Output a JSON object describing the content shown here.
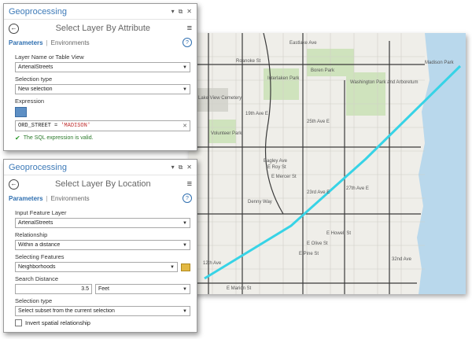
{
  "map": {
    "labels": [
      "Eastlake Ave",
      "Roanoke St",
      "Lake View Cemetery",
      "Interlaken Park",
      "Boren Park",
      "Volunteer Park",
      "Bagley Ave",
      "19th Ave E",
      "25th Ave E",
      "Washington Park and Arboretum",
      "E Roy St",
      "E Mercer St",
      "23rd Ave E",
      "27th Ave E",
      "Denny Way",
      "E Howell St",
      "E Olive St",
      "E Pine St",
      "E Marion St",
      "12th Ave",
      "32nd Ave",
      "Madison Park"
    ],
    "route_color": "#37d3e6"
  },
  "panel1": {
    "title": "Geoprocessing",
    "tool": "Select Layer By Attribute",
    "tab_params": "Parameters",
    "tab_env": "Environments",
    "f1_label": "Layer Name or Table View",
    "f1_value": "ArterialStreets",
    "f2_label": "Selection type",
    "f2_value": "New selection",
    "expr_label": "Expression",
    "expr_field": "ORD_STREET",
    "expr_op": "=",
    "expr_value": "'MADISON'",
    "valid_msg": "The SQL expression is valid."
  },
  "panel2": {
    "title": "Geoprocessing",
    "tool": "Select Layer By Location",
    "tab_params": "Parameters",
    "tab_env": "Environments",
    "f1_label": "Input Feature Layer",
    "f1_value": "ArterialStreets",
    "f2_label": "Relationship",
    "f2_value": "Within a distance",
    "f3_label": "Selecting Features",
    "f3_value": "Neighborhoods",
    "f4_label": "Search Distance",
    "f4_value": "3.5",
    "f4_unit": "Feet",
    "f5_label": "Selection type",
    "f5_value": "Select subset from the current selection",
    "cb_label": "Invert spatial relationship"
  }
}
